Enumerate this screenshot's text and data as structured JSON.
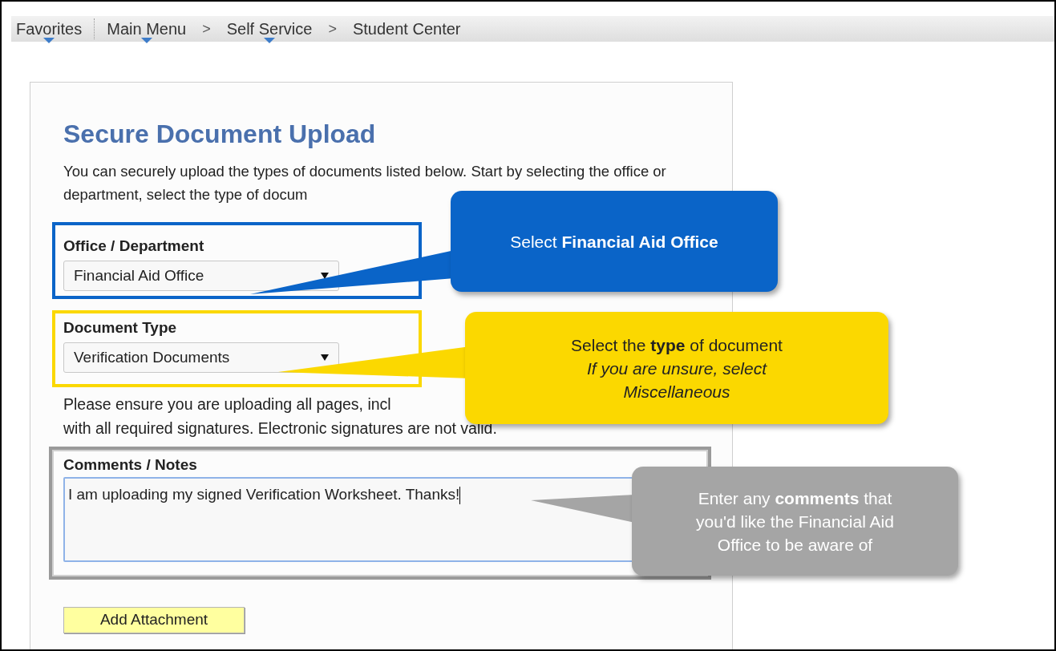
{
  "breadcrumb": [
    {
      "label": "Favorites",
      "menu": true
    },
    {
      "label": "Main Menu",
      "menu": true
    },
    {
      "label": "Self Service",
      "menu": true,
      "separator_before": ">"
    },
    {
      "label": "Student Center",
      "menu": false,
      "separator_before": ">"
    }
  ],
  "panel": {
    "title": "Secure Document Upload",
    "intro": "You can securely upload the types of documents listed below. Start by selecting the office or department, select the type of docum",
    "selects": [
      {
        "label": "Office / Department",
        "value": "Financial Aid Office",
        "color": "#0a64c8"
      },
      {
        "label": "Document Type",
        "value": "Verification Documents",
        "color": "#fbd800"
      }
    ],
    "note_lines": [
      "Please ensure you are uploading all pages, incl",
      "with all required signatures. Electronic signatures are not valid."
    ],
    "comments": {
      "label": "Comments / Notes",
      "value": "I am uploading my signed Verification Worksheet. Thanks!",
      "focused": true,
      "color": "#9a9a9a"
    },
    "button": "Add Attachment"
  },
  "callouts": [
    {
      "lines": [
        "Select **Financial Aid Office**"
      ],
      "color": "#0a64c8"
    },
    {
      "lines": [
        "Select the **type** of document",
        "*If you are unsure, select*",
        "*Miscellaneous*"
      ],
      "color": "#fbd800"
    },
    {
      "lines": [
        "Enter any **comments** that",
        "you'd like the Financial Aid",
        "Office to be aware of"
      ],
      "color": "#a5a5a5"
    }
  ]
}
